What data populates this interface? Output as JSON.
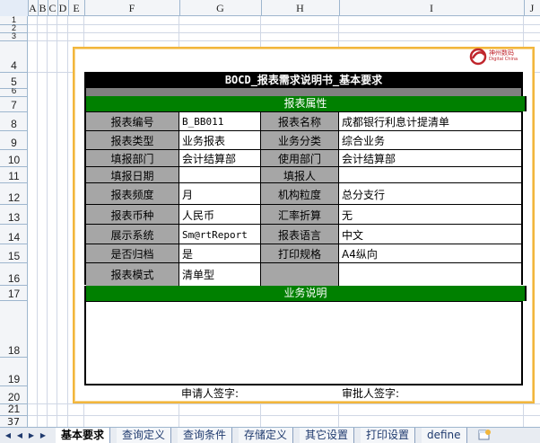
{
  "columns": [
    "A",
    "B",
    "C",
    "D",
    "E",
    "F",
    "G",
    "H",
    "I",
    "J"
  ],
  "rows": [
    "1",
    "2",
    "3",
    "4",
    "5",
    "6",
    "7",
    "8",
    "9",
    "10",
    "11",
    "12",
    "13",
    "14",
    "15",
    "16",
    "17",
    "18",
    "19",
    "20",
    "21",
    "22",
    "37"
  ],
  "logo": {
    "name_cn": "神州数码",
    "name_en": "Digital China",
    "color": "#c0262d"
  },
  "report": {
    "title": "BOCD_报表需求说明书_基本要求",
    "section_attr": "报表属性",
    "section_desc": "业务说明",
    "fields": [
      {
        "l1": "报表编号",
        "v1": "B_BB011",
        "l2": "报表名称",
        "v2": "成都银行利息计提清单"
      },
      {
        "l1": "报表类型",
        "v1": "业务报表",
        "l2": "业务分类",
        "v2": "综合业务"
      },
      {
        "l1": "填报部门",
        "v1": "会计结算部",
        "l2": "使用部门",
        "v2": "会计结算部"
      },
      {
        "l1": "填报日期",
        "v1": "",
        "l2": "填报人",
        "v2": ""
      },
      {
        "l1": "报表频度",
        "v1": "月",
        "l2": "机构粒度",
        "v2": "总分支行"
      },
      {
        "l1": "报表币种",
        "v1": "人民币",
        "l2": "汇率折算",
        "v2": "无"
      },
      {
        "l1": "展示系统",
        "v1": "Sm@rtReport",
        "l2": "报表语言",
        "v2": "中文"
      },
      {
        "l1": "是否归档",
        "v1": "是",
        "l2": "打印规格",
        "v2": "A4纵向"
      },
      {
        "l1": "报表模式",
        "v1": "清单型",
        "l2": "",
        "v2": ""
      }
    ],
    "applicant_sign": "申请人签字:",
    "approver_sign": "审批人签字:"
  },
  "sheet_tabs": [
    "基本要求",
    "查询定义",
    "查询条件",
    "存储定义",
    "其它设置",
    "打印设置",
    "define"
  ],
  "active_tab": "基本要求",
  "colors": {
    "section_green": "#008000",
    "title_black": "#000000",
    "label_grey": "#a6a6a6",
    "frame_orange": "#f2b63c"
  }
}
